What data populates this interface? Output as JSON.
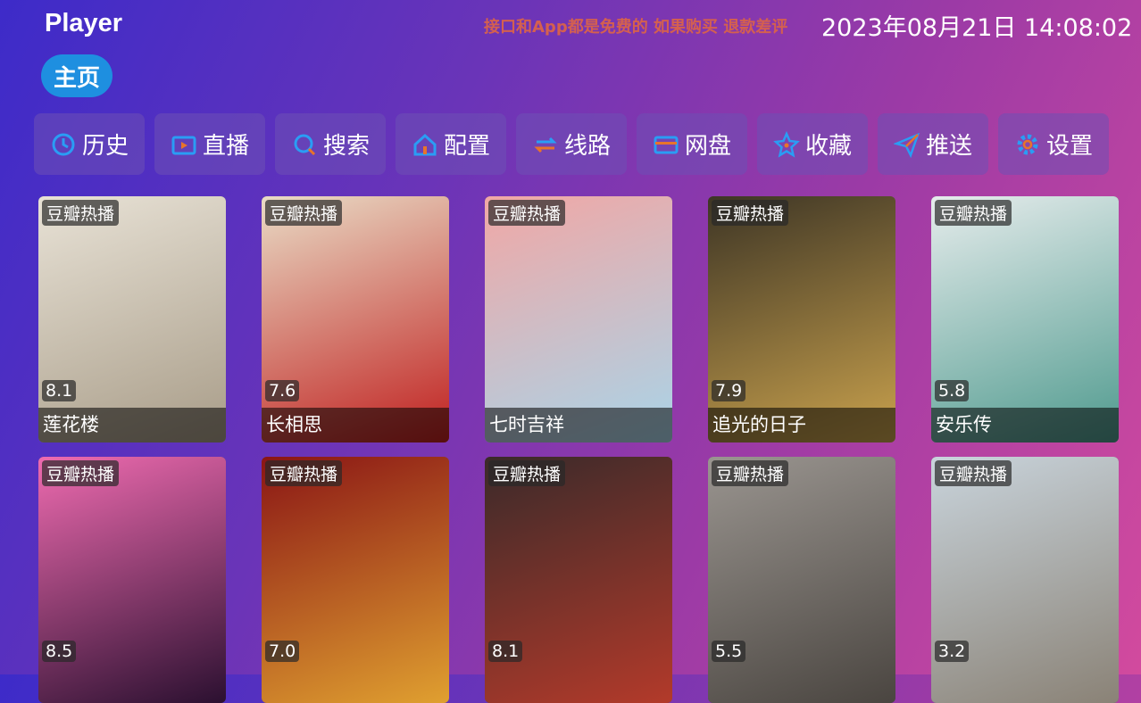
{
  "app_title": "Player",
  "notice": "接口和App都是免费的 如果购买 退款差评",
  "clock": "2023年08月21日 14:08:02",
  "home_tab": "主页",
  "toolbar": [
    {
      "label": "历史",
      "icon": "history-icon"
    },
    {
      "label": "直播",
      "icon": "tv-icon"
    },
    {
      "label": "搜索",
      "icon": "search-icon"
    },
    {
      "label": "配置",
      "icon": "home-config-icon"
    },
    {
      "label": "线路",
      "icon": "route-icon"
    },
    {
      "label": "网盘",
      "icon": "card-icon"
    },
    {
      "label": "收藏",
      "icon": "star-icon"
    },
    {
      "label": "推送",
      "icon": "send-icon"
    },
    {
      "label": "设置",
      "icon": "gear-icon"
    }
  ],
  "colors": {
    "accent": "#1e8fe0",
    "icon_blue": "#2a9df4",
    "notice": "#d4604f"
  },
  "cards": [
    {
      "tag": "豆瓣热播",
      "score": "8.1",
      "title": "莲花楼",
      "colors": [
        "#e8e2d6",
        "#a89c88"
      ]
    },
    {
      "tag": "豆瓣热播",
      "score": "7.6",
      "title": "长相思",
      "colors": [
        "#e9dcc6",
        "#c0201f"
      ]
    },
    {
      "tag": "豆瓣热播",
      "score": "",
      "title": "七时吉祥",
      "colors": [
        "#f1a7a5",
        "#a9d4e8"
      ]
    },
    {
      "tag": "豆瓣热播",
      "score": "7.9",
      "title": "追光的日子",
      "colors": [
        "#3d3525",
        "#caa24d"
      ]
    },
    {
      "tag": "豆瓣热播",
      "score": "5.8",
      "title": "安乐传",
      "colors": [
        "#e6ecec",
        "#4f9a8e"
      ]
    },
    {
      "tag": "豆瓣热播",
      "score": "8.5",
      "title": "",
      "colors": [
        "#ef6bb0",
        "#2b1030"
      ]
    },
    {
      "tag": "豆瓣热播",
      "score": "7.0",
      "title": "",
      "colors": [
        "#8a1515",
        "#e0a030"
      ]
    },
    {
      "tag": "豆瓣热播",
      "score": "8.1",
      "title": "",
      "colors": [
        "#3a2a2a",
        "#b33a2a"
      ]
    },
    {
      "tag": "豆瓣热播",
      "score": "5.5",
      "title": "",
      "colors": [
        "#9a9590",
        "#4a4540"
      ]
    },
    {
      "tag": "豆瓣热播",
      "score": "3.2",
      "title": "",
      "colors": [
        "#c9d4dc",
        "#8a8276"
      ]
    }
  ]
}
